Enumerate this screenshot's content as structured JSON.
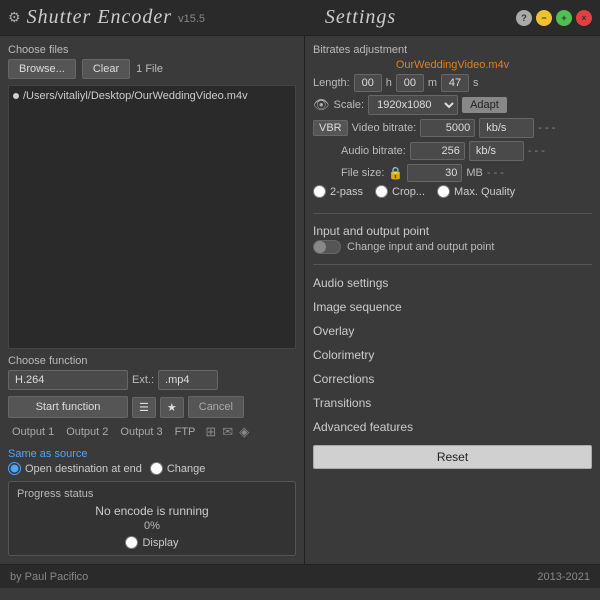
{
  "titleBar": {
    "appTitle": "Shutter  Encoder",
    "version": "v15.5",
    "settingsTitle": "Settings"
  },
  "leftPanel": {
    "chooseFilesLabel": "Choose files",
    "browseLabel": "Browse...",
    "clearLabel": "Clear",
    "fileCount": "1 File",
    "filePath": "/Users/vitaliyl/Desktop/OurWeddingVideo.m4v",
    "chooseFunctionLabel": "Choose function",
    "functionValue": "H.264",
    "extLabel": "Ext.:",
    "extValue": ".mp4",
    "startLabel": "Start function",
    "cancelLabel": "Cancel",
    "outputTabs": [
      "Output 1",
      "Output 2",
      "Output 3",
      "FTP"
    ],
    "sameAsSource": "Same as source",
    "openDestLabel": "Open destination at end",
    "changeLabel": "Change",
    "progressLabel": "Progress status",
    "progressStatus": "No encode is running",
    "progressPercent": "0%",
    "displayLabel": "Display"
  },
  "rightPanel": {
    "bitratesLabel": "Bitrates adjustment",
    "fileName": "OurWeddingVideo.m4v",
    "lengthLabel": "Length:",
    "lengthH": "00",
    "lengthM": "00",
    "hLabel": "h",
    "mLabel": "m",
    "lengthS": "47",
    "sLabel": "s",
    "scaleLabel": "Scale:",
    "scaleValue": "1920x1080",
    "adaptLabel": "Adapt",
    "vbrLabel": "VBR",
    "videoBitrateLabel": "Video bitrate:",
    "videoBitrateValue": "5000",
    "videoBitrateUnit": "kb/s",
    "audioBitrateLabel": "Audio bitrate:",
    "audioBitrateValue": "256",
    "audioBitrateUnit": "kb/s",
    "fileSizeLabel": "File size:",
    "fileSizeValue": "30",
    "fileSizeUnit": "MB",
    "twoPassLabel": "2-pass",
    "cropLabel": "Crop...",
    "maxQualityLabel": "Max. Quality",
    "inputOutputLabel": "Input and output point",
    "changeInputOutputLabel": "Change input and output point",
    "audioSettingsLabel": "Audio settings",
    "imageSequenceLabel": "Image sequence",
    "overlayLabel": "Overlay",
    "colorimetryLabel": "Colorimetry",
    "correctionsLabel": "Corrections",
    "transitionsLabel": "Transitions",
    "advancedFeaturesLabel": "Advanced features",
    "resetLabel": "Reset"
  },
  "bottomBar": {
    "author": "by Paul Pacifico",
    "year": "2013-2021"
  }
}
